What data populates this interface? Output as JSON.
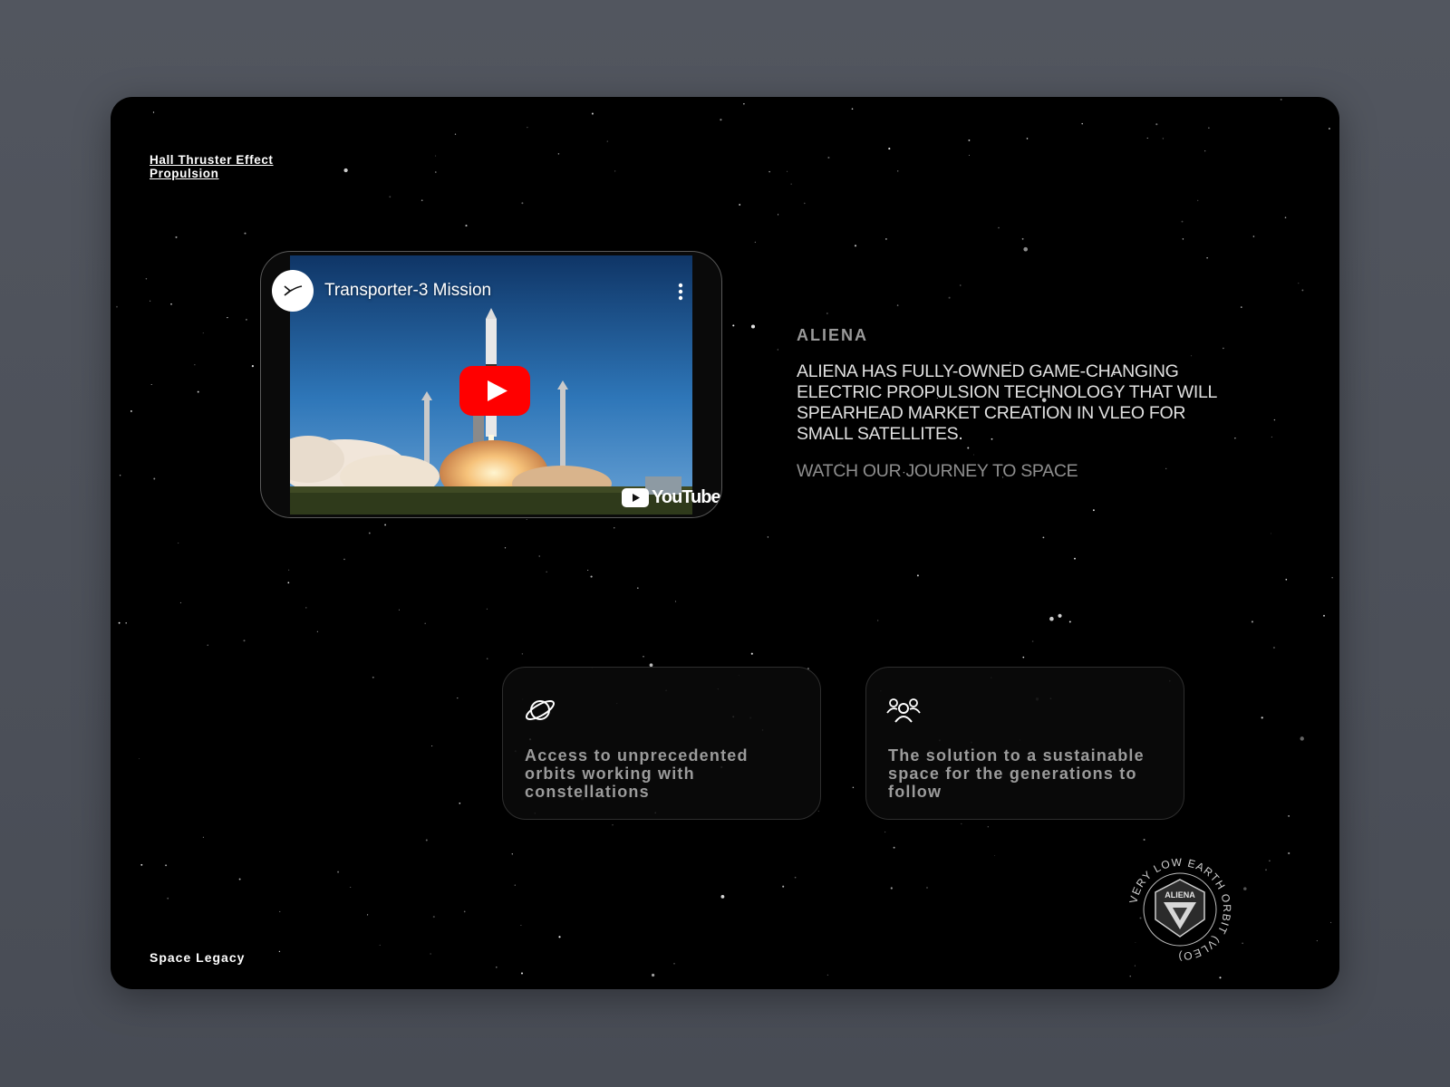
{
  "nav": {
    "link_label": "Hall Thruster Effect Propulsion"
  },
  "video": {
    "title": "Transporter-3 Mission",
    "channel_icon": "spacex-logo-icon",
    "menu_icon": "vertical-dots-icon",
    "play_icon": "youtube-play-icon",
    "platform_label": "YouTube"
  },
  "about": {
    "label": "ALIENA",
    "headline": "ALIENA HAS FULLY-OWNED GAME-CHANGING ELECTRIC PROPULSION TECHNOLOGY THAT WILL SPEARHEAD MARKET CREATION IN VLEO FOR SMALL SATELLITES.",
    "cta": "WATCH OUR JOURNEY TO SPACE"
  },
  "features": [
    {
      "icon": "planet-icon",
      "text": "Access to unprecedented orbits working with constellations"
    },
    {
      "icon": "group-icon",
      "text": "The solution to a sustainable space for the generations to follow"
    }
  ],
  "badge": {
    "ring_text": "VERY LOW EARTH ORBIT (VLEO)",
    "logo_text": "ALIENA"
  },
  "footer": {
    "label": "Space Legacy"
  },
  "colors": {
    "page_bg": "#4e525b",
    "frame_bg": "#000000",
    "play_red": "#ff0000",
    "muted_text": "#9b9b9b"
  }
}
